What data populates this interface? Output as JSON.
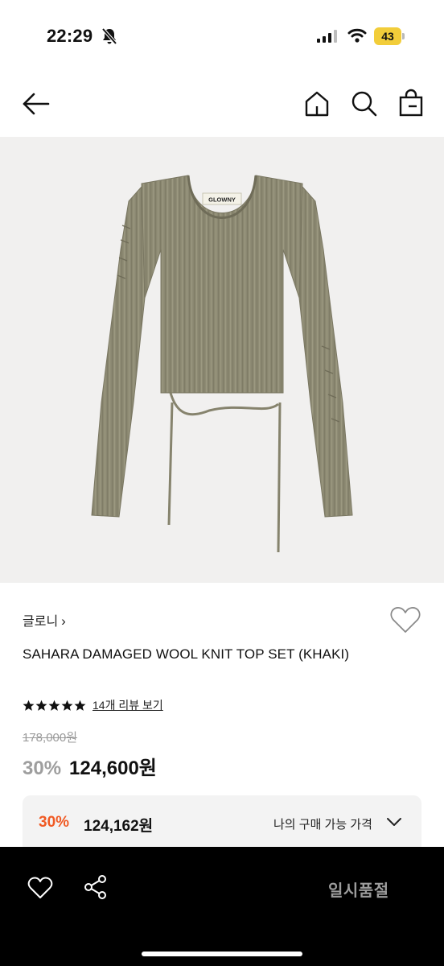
{
  "status_bar": {
    "time": "22:29",
    "battery": "43"
  },
  "product": {
    "image_label": "GLOWNY",
    "brand": "글로니",
    "brand_chevron": "›",
    "title": "SAHARA DAMAGED WOOL KNIT TOP SET (KHAKI)",
    "rating": 5,
    "review_text": "14개 리뷰 보기",
    "original_price": "178,000원",
    "discount": "30%",
    "sale_price": "124,600원"
  },
  "my_price": {
    "discount": "30%",
    "price": "124,162원",
    "label": "나의 구매 가능 가격"
  },
  "bottom_bar": {
    "status_label": "일시품절"
  },
  "colors": {
    "accent": "#f05a24",
    "knit": "#8e8b74",
    "battery": "#f2cd3a"
  }
}
